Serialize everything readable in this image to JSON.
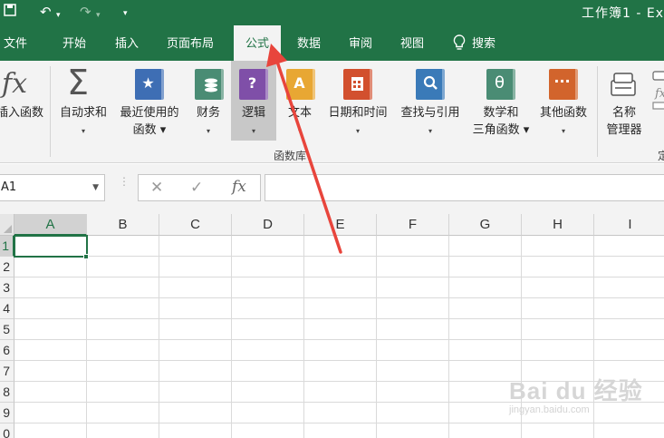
{
  "window": {
    "title": "工作簿1 - Ex"
  },
  "quick_access": {
    "undo_glyph": "↶",
    "redo_glyph": "↷",
    "more_glyph": "▾"
  },
  "tabs": [
    {
      "label": "文件"
    },
    {
      "label": "开始"
    },
    {
      "label": "插入"
    },
    {
      "label": "页面布局"
    },
    {
      "label": "公式",
      "active": true
    },
    {
      "label": "数据"
    },
    {
      "label": "审阅"
    },
    {
      "label": "视图"
    }
  ],
  "search": {
    "label": "搜索",
    "icon": "lightbulb-icon"
  },
  "ribbon": {
    "insert_function": {
      "icon_text": "fx",
      "label": "插入函数"
    },
    "autosum": {
      "icon_text": "Σ",
      "label": "自动求和",
      "arrow": "▾"
    },
    "recent": {
      "label_line1": "最近使用的",
      "label_line2": "函数 ▾",
      "icon": "star-book-icon",
      "color": "#3e6eb4"
    },
    "financial": {
      "label": "财务",
      "arrow": "▾",
      "icon": "coins-book-icon",
      "color": "#4a8c74"
    },
    "logical": {
      "label": "逻辑",
      "arrow": "▾",
      "icon_text": "?",
      "color": "#7f4fa8",
      "selected": true
    },
    "text": {
      "label": "文本",
      "arrow": "▾",
      "icon_text": "A",
      "color": "#e8a733"
    },
    "datetime": {
      "label": "日期和时间",
      "arrow": "▾",
      "icon": "calendar-book-icon",
      "color": "#d2502e"
    },
    "lookup": {
      "label": "查找与引用",
      "arrow": "▾",
      "icon": "magnifier-book-icon",
      "color": "#3a7ab8"
    },
    "math": {
      "label_line1": "数学和",
      "label_line2": "三角函数 ▾",
      "icon_text": "θ",
      "color": "#4a8c74"
    },
    "more": {
      "label": "其他函数",
      "arrow": "▾",
      "icon_text": "···",
      "color": "#d2642c"
    },
    "name_manager": {
      "label_line1": "名称",
      "label_line2": "管理器"
    },
    "group_label": "函数库",
    "partial_right": "定"
  },
  "formula_bar": {
    "name_box": "A1",
    "cancel_glyph": "✕",
    "enter_glyph": "✓",
    "fx_glyph": "fx",
    "formula": ""
  },
  "grid": {
    "columns": [
      "A",
      "B",
      "C",
      "D",
      "E",
      "F",
      "G",
      "H",
      "I"
    ],
    "rows": [
      "1",
      "2",
      "3",
      "4",
      "5",
      "6",
      "7",
      "8",
      "9",
      "0"
    ],
    "selected_cell": "A1"
  },
  "watermark": {
    "big": "Bai du 经验",
    "small": "jingyan.baidu.com"
  },
  "colors": {
    "excel_green": "#217346",
    "arrow_red": "#e8453c"
  }
}
